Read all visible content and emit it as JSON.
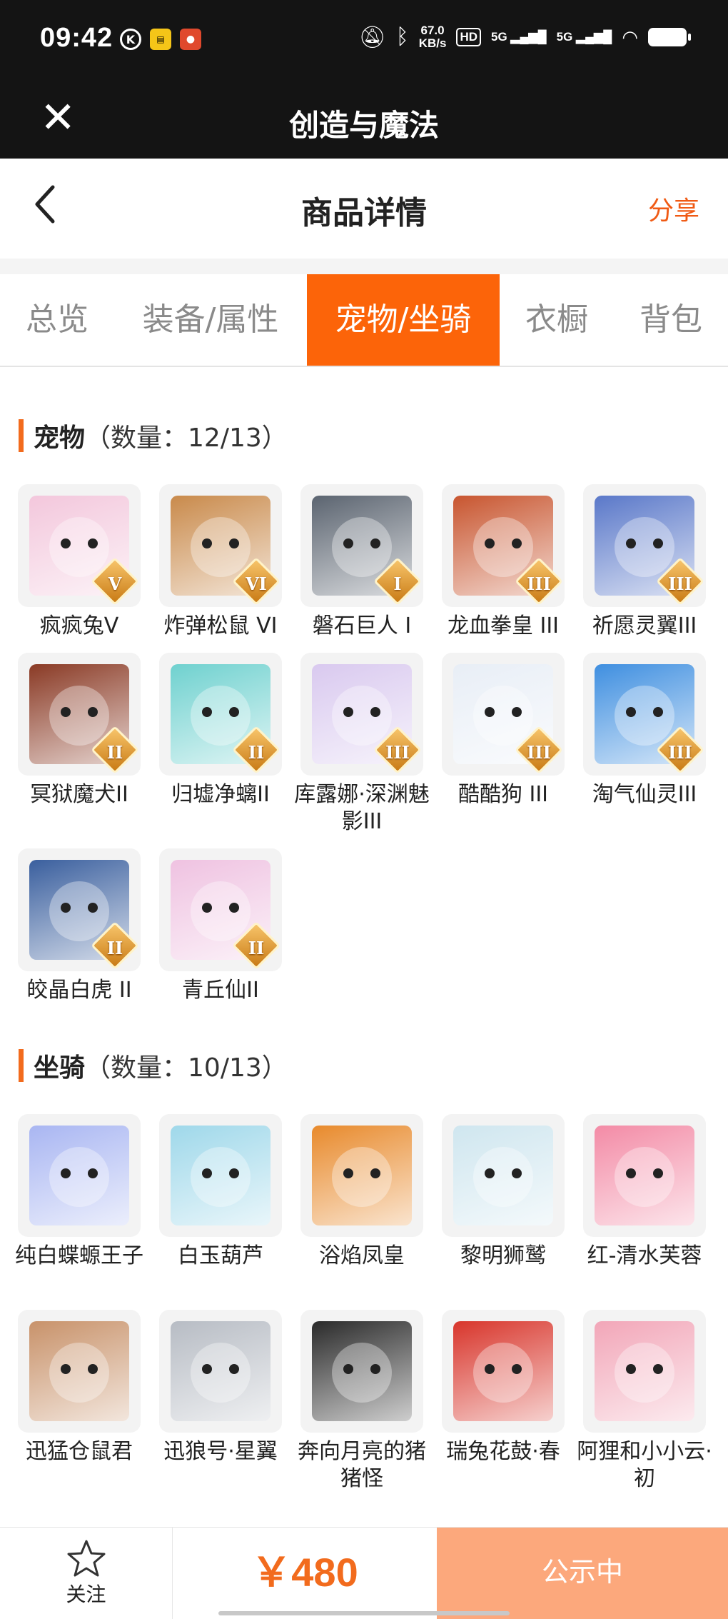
{
  "status_bar": {
    "time": "09:42",
    "speed": "67.0",
    "speed_unit": "KB/s",
    "hd": "HD",
    "net1": "5G",
    "net2": "5G"
  },
  "app_bar": {
    "title": "创造与魔法"
  },
  "header": {
    "title": "商品详情",
    "share": "分享"
  },
  "tabs": [
    {
      "label": "总览",
      "active": false
    },
    {
      "label": "装备/属性",
      "active": false
    },
    {
      "label": "宠物/坐骑",
      "active": true
    },
    {
      "label": "衣橱",
      "active": false
    },
    {
      "label": "背包",
      "active": false
    }
  ],
  "pets": {
    "title": "宠物",
    "count": "（数量：12/13）",
    "items": [
      {
        "name": "疯疯兔V",
        "tier": "V",
        "color": "#f3c7dc"
      },
      {
        "name": "炸弹松鼠 VI",
        "tier": "VI",
        "color": "#c98a4b"
      },
      {
        "name": "磐石巨人 I",
        "tier": "I",
        "color": "#5b6470"
      },
      {
        "name": "龙血拳皇 III",
        "tier": "III",
        "color": "#c8552f"
      },
      {
        "name": "祈愿灵翼III",
        "tier": "III",
        "color": "#5a78c9"
      },
      {
        "name": "冥狱魔犬II",
        "tier": "II",
        "color": "#8a3a25"
      },
      {
        "name": "归墟净螭II",
        "tier": "II",
        "color": "#6fd1cf"
      },
      {
        "name": "库露娜·深渊魅影III",
        "tier": "III",
        "color": "#d9c9ef"
      },
      {
        "name": "酷酷狗 III",
        "tier": "III",
        "color": "#e8eef6"
      },
      {
        "name": "淘气仙灵III",
        "tier": "III",
        "color": "#3f8fe0"
      },
      {
        "name": "皎晶白虎 II",
        "tier": "II",
        "color": "#3a5f9e"
      },
      {
        "name": "青丘仙II",
        "tier": "II",
        "color": "#efc2e1"
      }
    ]
  },
  "mounts": {
    "title": "坐骑",
    "count": "（数量：10/13）",
    "items": [
      {
        "name": "纯白蝶螈王子",
        "color": "#a9b6f2"
      },
      {
        "name": "白玉葫芦",
        "color": "#9fd8ea"
      },
      {
        "name": "浴焰凤皇",
        "color": "#e88a2c"
      },
      {
        "name": "黎明狮鹫",
        "color": "#cfe6ef"
      },
      {
        "name": "红-清水芙蓉",
        "color": "#f38ba6"
      },
      {
        "name": "迅猛仓鼠君",
        "color": "#c8926a"
      },
      {
        "name": "迅狼号·星翼",
        "color": "#b7bcc4"
      },
      {
        "name": "奔向月亮的猪猪怪",
        "color": "#2a2a2a"
      },
      {
        "name": "瑞兔花鼓·春",
        "color": "#d8352b"
      },
      {
        "name": "阿狸和小小云·初",
        "color": "#f2a6b8"
      }
    ]
  },
  "bottom": {
    "follow": "关注",
    "price": "￥480",
    "status": "公示中"
  },
  "colors": {
    "accent": "#fc6409",
    "status_button": "#fca87c"
  }
}
